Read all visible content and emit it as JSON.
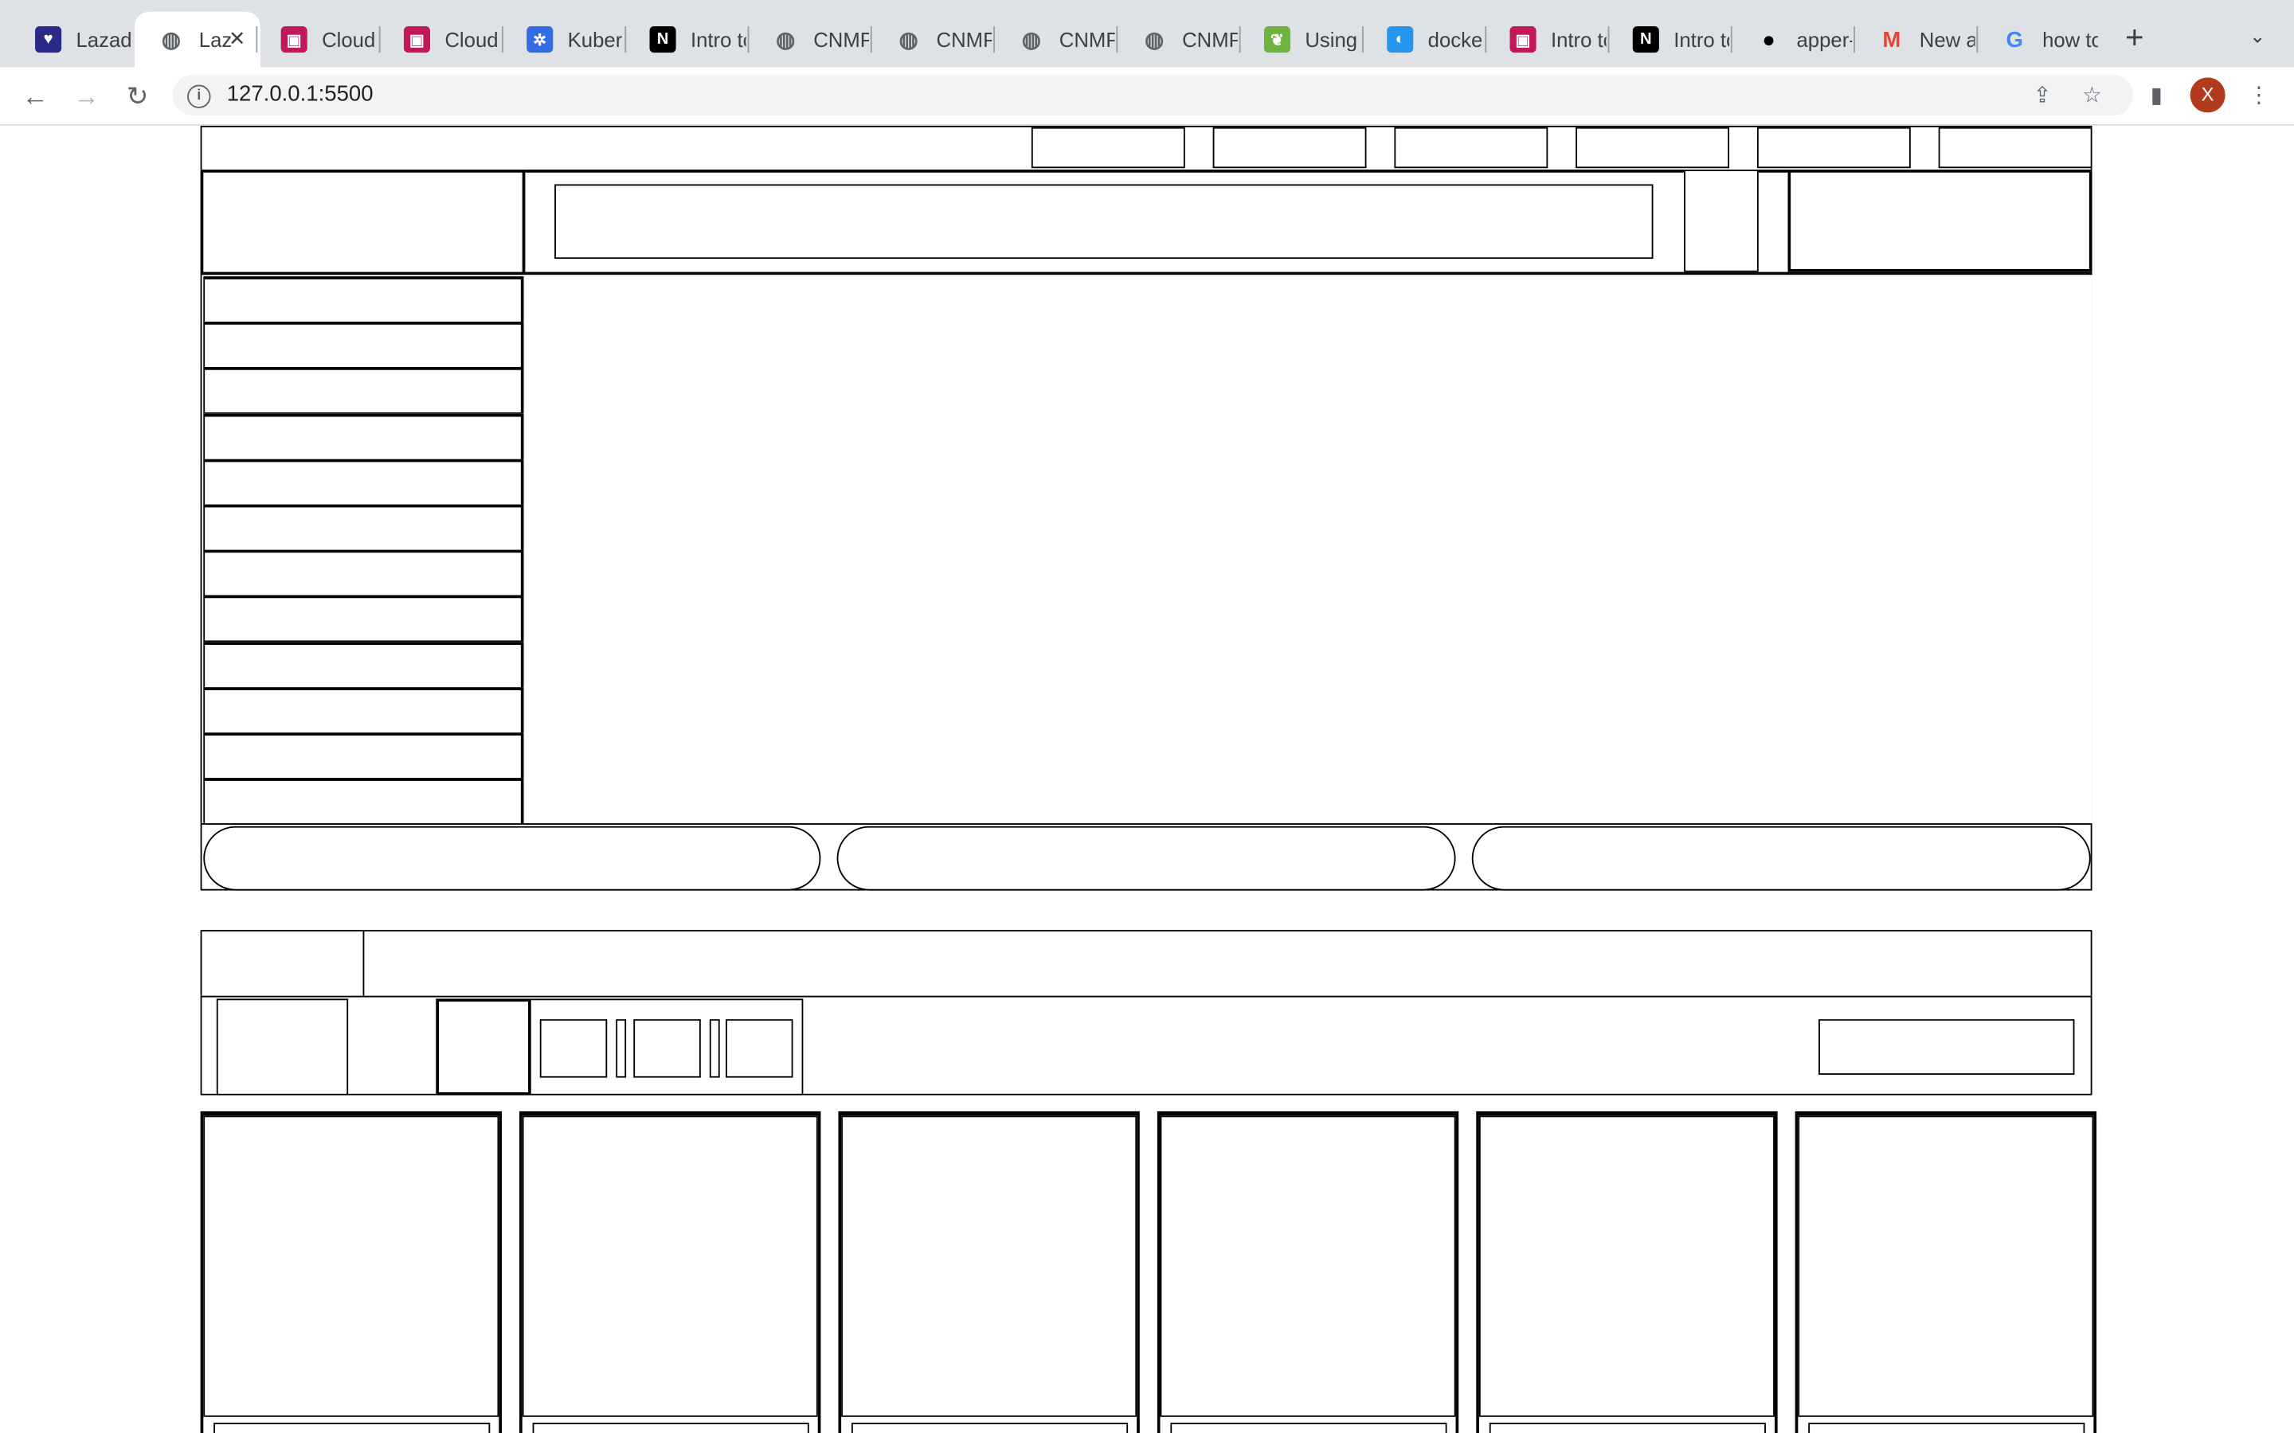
{
  "browser": {
    "tabs": [
      {
        "title": "Lazada",
        "favicon": "lazada-icon",
        "color": "#2a2a8a"
      },
      {
        "title": "Laz",
        "favicon": "globe-icon",
        "color": "#5f6368",
        "active": true
      },
      {
        "title": "Cloud",
        "favicon": "contact-icon",
        "color": "#c2185b"
      },
      {
        "title": "Cloud",
        "favicon": "contact-icon",
        "color": "#c2185b"
      },
      {
        "title": "Kuber",
        "favicon": "kubernetes-icon",
        "color": "#326ce5"
      },
      {
        "title": "Intro to",
        "favicon": "notion-icon",
        "color": "#000000"
      },
      {
        "title": "CNMP",
        "favicon": "globe-icon",
        "color": "#5f6368"
      },
      {
        "title": "CNMP",
        "favicon": "globe-icon",
        "color": "#5f6368"
      },
      {
        "title": "CNMP",
        "favicon": "globe-icon",
        "color": "#5f6368"
      },
      {
        "title": "CNMP",
        "favicon": "globe-icon",
        "color": "#5f6368"
      },
      {
        "title": "Using",
        "favicon": "leaf-icon",
        "color": "#6db33f"
      },
      {
        "title": "docker",
        "favicon": "docker-icon",
        "color": "#2496ed"
      },
      {
        "title": "Intro to",
        "favicon": "contact-icon",
        "color": "#c2185b"
      },
      {
        "title": "Intro to",
        "favicon": "notion-icon",
        "color": "#000000"
      },
      {
        "title": "apper-",
        "favicon": "github-icon",
        "color": "#000000"
      },
      {
        "title": "New a",
        "favicon": "gmail-icon",
        "color": "#ea4335"
      },
      {
        "title": "how to",
        "favicon": "google-icon",
        "color": "#4285f4"
      }
    ],
    "url": "127.0.0.1:5500",
    "avatar_letter": "X",
    "avatar_color": "#b23a1f"
  },
  "page": {
    "top_links": [
      "",
      "",
      "",
      "",
      "",
      ""
    ],
    "sidebar_items": [
      "",
      "",
      "",
      "",
      "",
      "",
      "",
      "",
      "",
      "",
      "",
      ""
    ],
    "banner_buttons": [
      "",
      "",
      ""
    ],
    "product_cards": [
      "",
      "",
      "",
      "",
      "",
      ""
    ]
  }
}
